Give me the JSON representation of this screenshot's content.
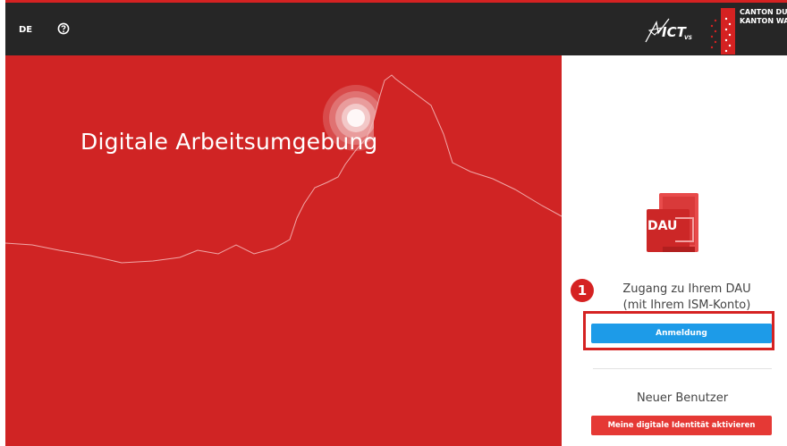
{
  "header": {
    "language": "DE",
    "help_icon": "help-circle-icon",
    "logo_text": "ICT",
    "logo_sub": "VS",
    "canton_line1": "CANTON DU VALAIS",
    "canton_line2": "KANTON WALLIS"
  },
  "hero": {
    "title": "Digitale Arbeitsumgebung",
    "background_color": "#d02424"
  },
  "panel": {
    "app_icon_label": "DAU",
    "step_marker": "1",
    "access_line1": "Zugang zu Ihrem DAU",
    "access_line2": "(mit Ihrem ISM-Konto)",
    "login_label": "Anmeldung",
    "new_user_label": "Neuer Benutzer",
    "activate_label": "Meine digitale Identität aktivieren"
  },
  "colors": {
    "brand_red": "#d52222",
    "button_blue": "#1d9be8",
    "button_red": "#e53935",
    "topbar": "#262626"
  }
}
